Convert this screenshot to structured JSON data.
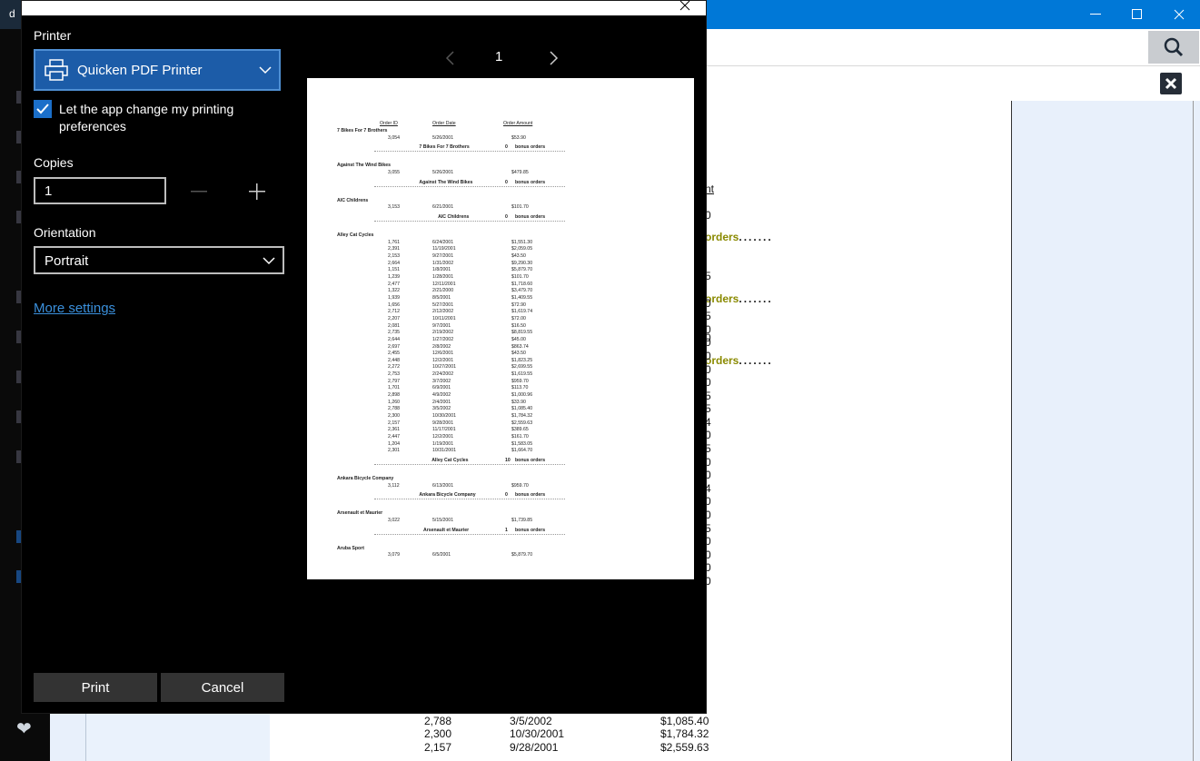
{
  "app": {
    "title_fragment": "d",
    "search_icon": "search-icon",
    "close_icon": "close-icon",
    "report_fragments": [
      {
        "text": "nt"
      },
      {
        "text": "0"
      },
      {
        "text": "5"
      },
      {
        "text": "0"
      }
    ],
    "orders_label": "orders",
    "bottom_rows": [
      {
        "id": "2,788",
        "date": "3/5/2002",
        "amount": "$1,085.40"
      },
      {
        "id": "2,300",
        "date": "10/30/2001",
        "amount": "$1,784.32"
      },
      {
        "id": "2,157",
        "date": "9/28/2001",
        "amount": "$2,559.63"
      }
    ],
    "right_digits": [
      "0",
      "5",
      "0",
      "0",
      "0",
      "0",
      "0",
      "5",
      "5",
      "4",
      "0",
      "5",
      "0",
      "0",
      "4",
      "0",
      "0",
      "5",
      "0",
      "0",
      "0",
      "0"
    ]
  },
  "dialog": {
    "printer_label": "Printer",
    "printer_name": "Quicken PDF Printer",
    "let_app_change": "Let the app change my printing preferences",
    "copies_label": "Copies",
    "copies_value": "1",
    "orientation_label": "Orientation",
    "orientation_value": "Portrait",
    "more_settings": "More settings",
    "print_button": "Print",
    "cancel_button": "Cancel",
    "page_number": "1",
    "accent_color": "#1c5ca8",
    "link_color": "#3a8fdb"
  },
  "preview": {
    "headers": [
      "Order ID",
      "Order Date",
      "Order Amount"
    ],
    "groups": [
      {
        "name": "7 Bikes For 7 Brothers",
        "rows": [
          [
            "3,054",
            "5/26/2001",
            "$53.90"
          ]
        ],
        "total_count": "0",
        "total_label": "bonus orders"
      },
      {
        "name": "Against The Wind Bikes",
        "rows": [
          [
            "3,055",
            "5/26/2001",
            "$479.85"
          ]
        ],
        "total_count": "0",
        "total_label": "bonus orders"
      },
      {
        "name": "AIC Childrens",
        "rows": [
          [
            "3,153",
            "6/21/2001",
            "$101.70"
          ]
        ],
        "total_count": "0",
        "total_label": "bonus orders"
      },
      {
        "name": "Alley Cat Cycles",
        "rows": [
          [
            "1,761",
            "6/24/2001",
            "$1,551.30"
          ],
          [
            "2,391",
            "11/19/2001",
            "$2,059.05"
          ],
          [
            "2,153",
            "9/27/2001",
            "$43.50"
          ],
          [
            "2,664",
            "1/31/2002",
            "$9,290.30"
          ],
          [
            "1,151",
            "1/8/2001",
            "$5,879.70"
          ],
          [
            "1,239",
            "1/28/2001",
            "$101.70"
          ],
          [
            "2,477",
            "12/11/2001",
            "$1,718.60"
          ],
          [
            "1,322",
            "2/21/2000",
            "$3,479.70"
          ],
          [
            "1,939",
            "8/5/2001",
            "$1,409.55"
          ],
          [
            "1,656",
            "5/27/2001",
            "$72.90"
          ],
          [
            "2,712",
            "2/12/2002",
            "$1,619.74"
          ],
          [
            "2,207",
            "10/11/2001",
            "$72.00"
          ],
          [
            "2,081",
            "9/7/2001",
            "$16.50"
          ],
          [
            "2,735",
            "2/19/2002",
            "$8,819.55"
          ],
          [
            "2,644",
            "1/27/2002",
            "$45.00"
          ],
          [
            "2,697",
            "2/8/2002",
            "$863.74"
          ],
          [
            "2,455",
            "12/6/2001",
            "$43.50"
          ],
          [
            "2,448",
            "12/2/2001",
            "$1,823.25"
          ],
          [
            "2,272",
            "10/27/2001",
            "$2,699.55"
          ],
          [
            "2,753",
            "2/24/2002",
            "$1,619.55"
          ],
          [
            "2,797",
            "3/7/2002",
            "$959.70"
          ],
          [
            "1,701",
            "6/9/2001",
            "$113.70"
          ],
          [
            "2,898",
            "4/9/2002",
            "$1,000.96"
          ],
          [
            "1,260",
            "2/4/2001",
            "$33.90"
          ],
          [
            "2,788",
            "3/5/2002",
            "$1,085.40"
          ],
          [
            "2,300",
            "10/30/2001",
            "$1,784.32"
          ],
          [
            "2,157",
            "9/28/2001",
            "$2,559.63"
          ],
          [
            "2,361",
            "11/17/2001",
            "$389.65"
          ],
          [
            "2,447",
            "12/2/2001",
            "$161.70"
          ],
          [
            "1,204",
            "1/19/2001",
            "$1,583.05"
          ],
          [
            "2,301",
            "10/31/2001",
            "$1,664.70"
          ]
        ],
        "total_count": "10",
        "total_label": "bonus orders"
      },
      {
        "name": "Ankara Bicycle Company",
        "rows": [
          [
            "3,112",
            "6/13/2001",
            "$959.70"
          ]
        ],
        "total_count": "0",
        "total_label": "bonus orders"
      },
      {
        "name": "Arsenault et Maurier",
        "rows": [
          [
            "3,022",
            "5/15/2001",
            "$1,739.85"
          ]
        ],
        "total_count": "1",
        "total_label": "bonus orders"
      },
      {
        "name": "Aruba Sport",
        "rows": [
          [
            "3,079",
            "6/5/2001",
            "$5,879.70"
          ]
        ],
        "total_count": "",
        "total_label": ""
      }
    ]
  }
}
